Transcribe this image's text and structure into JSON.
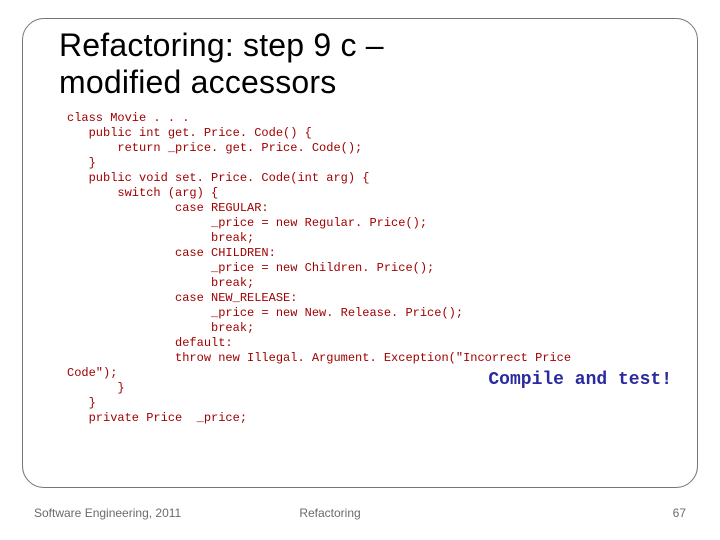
{
  "title_line1": "Refactoring: step 9 c –",
  "title_line2": "modified accessors",
  "code": "class Movie . . .\n   public int get. Price. Code() {\n       return _price. get. Price. Code();\n   }\n   public void set. Price. Code(int arg) {\n       switch (arg) {\n               case REGULAR:\n                    _price = new Regular. Price();\n                    break;\n               case CHILDREN:\n                    _price = new Children. Price();\n                    break;\n               case NEW_RELEASE:\n                    _price = new New. Release. Price();\n                    break;\n               default:\n               throw new Illegal. Argument. Exception(\"Incorrect Price\nCode\");\n       }\n   }\n   private Price  _price;",
  "callout": "Compile and test!",
  "footer": {
    "left": "Software Engineering, 2011",
    "center": "Refactoring",
    "page": "67"
  }
}
